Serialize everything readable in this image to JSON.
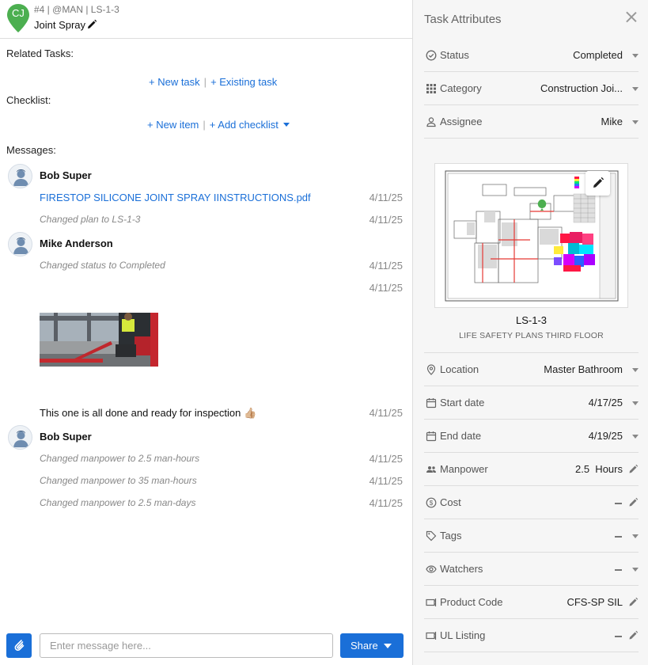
{
  "header": {
    "initials": "CJ",
    "pin_color": "#4caf50",
    "meta": "#4 | @MAN | LS-1-3",
    "title": "Joint Spray"
  },
  "related_tasks": {
    "label": "Related Tasks:",
    "new_task": "+ New task",
    "existing_task": "+ Existing task"
  },
  "checklist": {
    "label": "Checklist:",
    "new_item": "+ New item",
    "add_checklist": "+ Add checklist"
  },
  "messages": {
    "label": "Messages:",
    "groups": [
      {
        "author": "Bob Super",
        "avatar": "user-avatar-icon"
      },
      {
        "author": "Mike Anderson",
        "avatar": "user-avatar-icon"
      },
      {
        "author": "Bob Super",
        "avatar": "user-avatar-icon"
      }
    ],
    "items": [
      {
        "text": "FIRESTOP SILICONE JOINT SPRAY IINSTRUCTIONS.pdf",
        "date": "4/11/25"
      },
      {
        "text": "Changed plan to LS-1-3",
        "date": "4/11/25"
      },
      {
        "text": "Changed status to Completed",
        "date": "4/11/25"
      },
      {
        "text": "",
        "date": "4/11/25"
      },
      {
        "text": "This one is all done and ready for inspection",
        "date": "4/11/25"
      },
      {
        "text": "Changed manpower to 2.5 man-hours",
        "date": "4/11/25"
      },
      {
        "text": "Changed manpower to 35 man-hours",
        "date": "4/11/25"
      },
      {
        "text": "Changed manpower to 2.5 man-days",
        "date": "4/11/25"
      }
    ],
    "thumbs_emoji": "👍🏼"
  },
  "composer": {
    "placeholder": "Enter message here...",
    "share": "Share"
  },
  "panel": {
    "title": "Task Attributes",
    "status": {
      "label": "Status",
      "value": "Completed"
    },
    "category": {
      "label": "Category",
      "value": "Construction Joi..."
    },
    "assignee": {
      "label": "Assignee",
      "value": "Mike"
    },
    "plan": {
      "name": "LS-1-3",
      "description": "LIFE SAFETY PLANS THIRD FLOOR"
    },
    "location": {
      "label": "Location",
      "value": "Master Bathroom"
    },
    "start_date": {
      "label": "Start date",
      "value": "4/17/25"
    },
    "end_date": {
      "label": "End date",
      "value": "4/19/25"
    },
    "manpower": {
      "label": "Manpower",
      "value": "2.5  Hours"
    },
    "cost": {
      "label": "Cost",
      "value": ""
    },
    "tags": {
      "label": "Tags",
      "value": ""
    },
    "watchers": {
      "label": "Watchers",
      "value": ""
    },
    "product_code": {
      "label": "Product Code",
      "value": "CFS-SP SIL"
    },
    "ul_listing": {
      "label": "UL Listing",
      "value": ""
    }
  },
  "colors": {
    "accent": "#1a6fd8",
    "panel_bg": "#f6f6f6"
  }
}
